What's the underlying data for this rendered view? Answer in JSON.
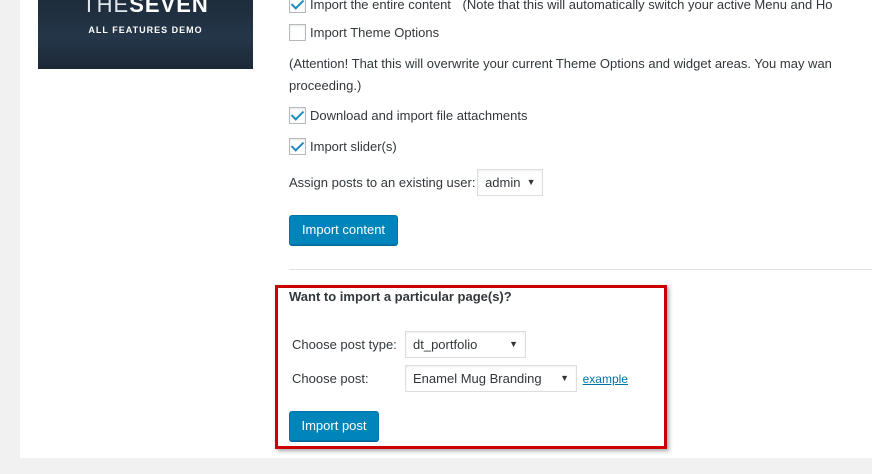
{
  "theme": {
    "title_thin": "THE",
    "title_bold": "SEVEN",
    "subtitle": "ALL FEATURES DEMO"
  },
  "options": {
    "import_entire_content": {
      "label": "Import the entire content",
      "note": "(Note that this will automatically switch your active Menu and Ho",
      "checked": true
    },
    "import_theme_options": {
      "label": "Import Theme Options",
      "checked": false
    },
    "attention_line1": "(Attention! That this will overwrite your current Theme Options and widget areas. You may wan",
    "attention_line2": "proceeding.)",
    "download_attachments": {
      "label": "Download and import file attachments",
      "checked": true
    },
    "import_sliders": {
      "label": "Import slider(s)",
      "checked": true
    },
    "assign_user_label": "Assign posts to an existing user:",
    "assign_user_value": "admin",
    "import_content_button": "Import content"
  },
  "particular": {
    "heading": "Want to import a particular page(s)?",
    "post_type_label": "Choose post type:",
    "post_type_value": "dt_portfolio",
    "post_label": "Choose post:",
    "post_value": "Enamel Mug Branding",
    "example_link": "example",
    "import_post_button": "Import post"
  },
  "colors": {
    "primary_button": "#0085ba",
    "highlight_border": "#cc0000",
    "checkmark": "#1e8cbe"
  }
}
